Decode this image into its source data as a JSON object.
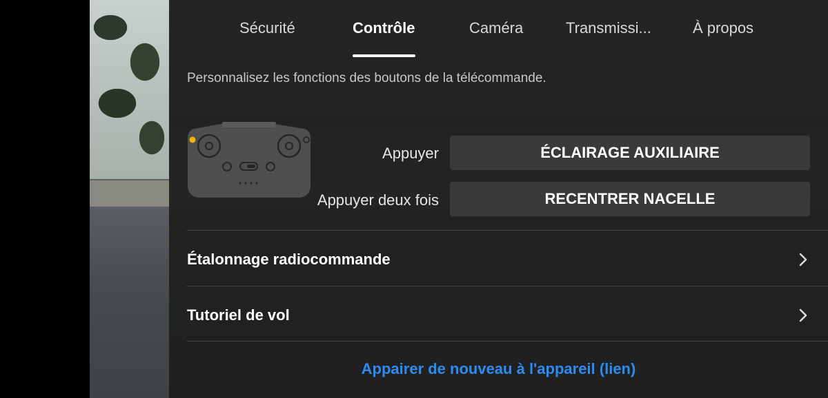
{
  "tabs": [
    {
      "label": "Sécurité",
      "active": false
    },
    {
      "label": "Contrôle",
      "active": true
    },
    {
      "label": "Caméra",
      "active": false
    },
    {
      "label": "Transmissi...",
      "active": false
    },
    {
      "label": "À propos",
      "active": false
    }
  ],
  "control": {
    "subtitle": "Personnalisez les fonctions des boutons de la télécommande.",
    "press_label": "Appuyer",
    "press_action": "ÉCLAIRAGE AUXILIAIRE",
    "double_press_label": "Appuyer deux fois",
    "double_press_action": "RECENTRER NACELLE",
    "rc_calibration": "Étalonnage radiocommande",
    "flight_tutorial": "Tutoriel de vol",
    "relink": "Appairer de nouveau à l'appareil (lien)"
  },
  "colors": {
    "link": "#2d8cf0",
    "indicator": "#f5b400",
    "panel": "#1e1e1e"
  },
  "icons": {
    "remote": "remote-controller-icon",
    "chevron": "chevron-right-icon"
  }
}
